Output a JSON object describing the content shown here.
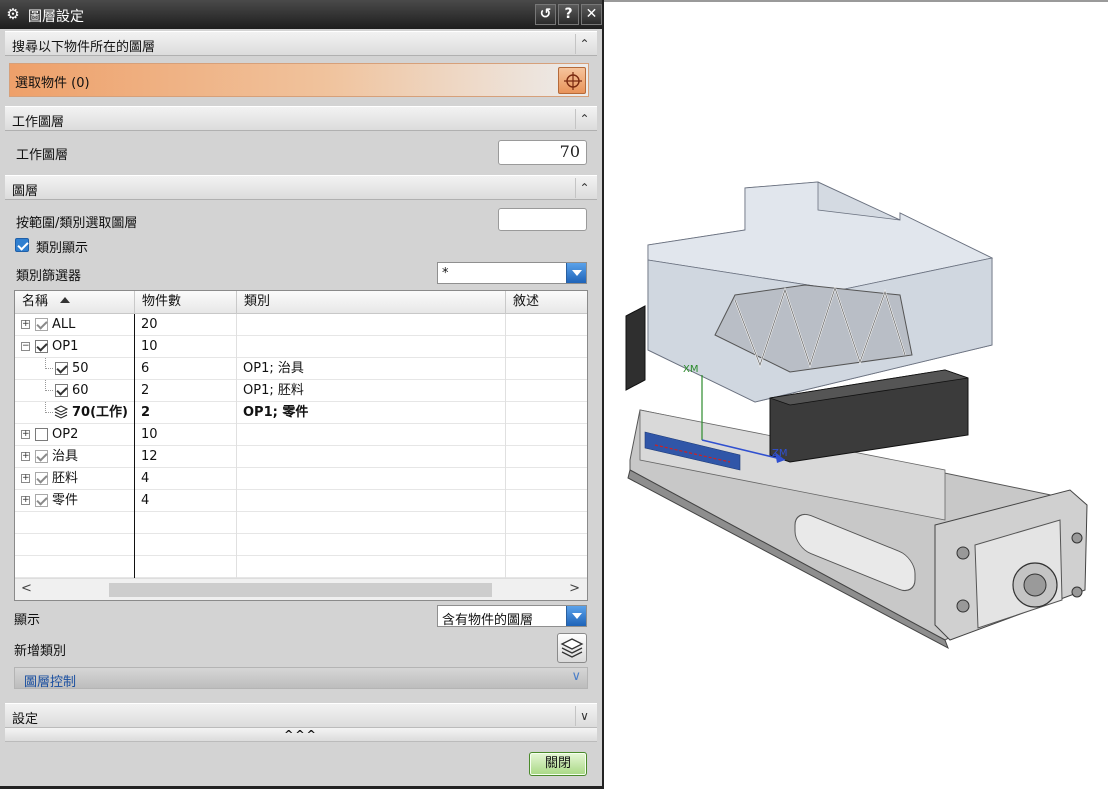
{
  "dialog": {
    "title": "圖層設定",
    "title_buttons": [
      {
        "icon": "reset-icon",
        "glyph": "↺"
      },
      {
        "icon": "help-icon",
        "glyph": "?"
      },
      {
        "icon": "close-icon",
        "glyph": "✕"
      }
    ]
  },
  "search_section": {
    "header": "搜尋以下物件所在的圖層",
    "select_label": "選取物件 (0)"
  },
  "work_layer_section": {
    "header": "工作圖層",
    "label": "工作圖層",
    "value": "70"
  },
  "layers_section": {
    "header": "圖層",
    "range_label": "按範圍/類別選取圖層",
    "range_value": "",
    "category_display_label": "類別顯示",
    "category_filter_label": "類別篩選器",
    "category_filter_value": "*",
    "columns": [
      "名稱",
      "物件數",
      "類別",
      "敘述"
    ],
    "rows": [
      {
        "name": "ALL",
        "count": "20",
        "category": "",
        "indent": 0,
        "expander": "+",
        "checked": true,
        "grey": true,
        "bold": false,
        "work": false
      },
      {
        "name": "OP1",
        "count": "10",
        "category": "",
        "indent": 0,
        "expander": "−",
        "checked": true,
        "grey": false,
        "bold": false,
        "work": false
      },
      {
        "name": "50",
        "count": "6",
        "category": "OP1; 治具",
        "indent": 1,
        "expander": "",
        "checked": true,
        "grey": false,
        "bold": false,
        "work": false
      },
      {
        "name": "60",
        "count": "2",
        "category": "OP1; 胚料",
        "indent": 1,
        "expander": "",
        "checked": true,
        "grey": false,
        "bold": false,
        "work": false
      },
      {
        "name": "70(工作)",
        "count": "2",
        "category": "OP1; 零件",
        "indent": 1,
        "expander": "",
        "checked": false,
        "grey": false,
        "bold": true,
        "work": true
      },
      {
        "name": "OP2",
        "count": "10",
        "category": "",
        "indent": 0,
        "expander": "+",
        "checked": false,
        "grey": false,
        "bold": false,
        "work": false
      },
      {
        "name": "治具",
        "count": "12",
        "category": "",
        "indent": 0,
        "expander": "+",
        "checked": true,
        "grey": true,
        "bold": false,
        "work": false
      },
      {
        "name": "胚料",
        "count": "4",
        "category": "",
        "indent": 0,
        "expander": "+",
        "checked": true,
        "grey": true,
        "bold": false,
        "work": false
      },
      {
        "name": "零件",
        "count": "4",
        "category": "",
        "indent": 0,
        "expander": "+",
        "checked": true,
        "grey": true,
        "bold": false,
        "work": false
      }
    ],
    "display_label": "顯示",
    "display_value": "含有物件的圖層",
    "add_category_label": "新增類別",
    "layer_control_label": "圖層控制"
  },
  "settings_section": {
    "header": "設定"
  },
  "expand_strip": "^^^",
  "close_button": "關閉",
  "colors": {
    "select_accent": "#eea06a",
    "checkbox_blue": "#2f7fd0",
    "close_green": "#a8d884",
    "layer_control_text": "#1a4fa0"
  }
}
